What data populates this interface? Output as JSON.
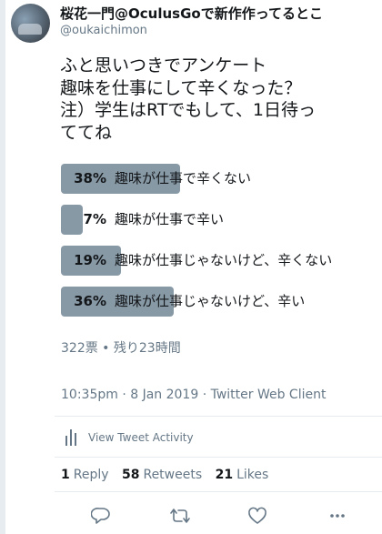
{
  "tweet": {
    "display_name": "桜花一門@OculusGoで新作作ってるとこ",
    "handle": "@oukaichimon",
    "text_lines": [
      "ふと思いつきでアンケート",
      "趣味を仕事にして辛くなった？",
      "注）学生はRTでもして、1日待っ",
      "ててね"
    ]
  },
  "poll": {
    "options": [
      {
        "percent_label": "38%",
        "label": "趣味が仕事で辛くない",
        "fraction": 0.38
      },
      {
        "percent_label": "7%",
        "label": "趣味が仕事で辛い",
        "fraction": 0.07
      },
      {
        "percent_label": "19%",
        "label": "趣味が仕事じゃないけど、辛くない",
        "fraction": 0.19
      },
      {
        "percent_label": "36%",
        "label": "趣味が仕事じゃないけど、辛い",
        "fraction": 0.36
      }
    ],
    "meta": "322票 • 残り23時間"
  },
  "timestamp": "10:35pm · 8 Jan 2019 · Twitter Web Client",
  "activity_label": "View Tweet Activity",
  "stats": {
    "replies_count": "1",
    "replies_label": "Reply",
    "retweets_count": "58",
    "retweets_label": "Retweets",
    "likes_count": "21",
    "likes_label": "Likes"
  },
  "icons": {
    "reply": "reply-icon",
    "retweet": "retweet-icon",
    "like": "heart-icon",
    "more": "more-icon",
    "activity": "bar-chart-icon"
  },
  "colors": {
    "poll_bar": "#8899a6",
    "secondary_text": "#657786",
    "primary_text": "#14171a"
  }
}
